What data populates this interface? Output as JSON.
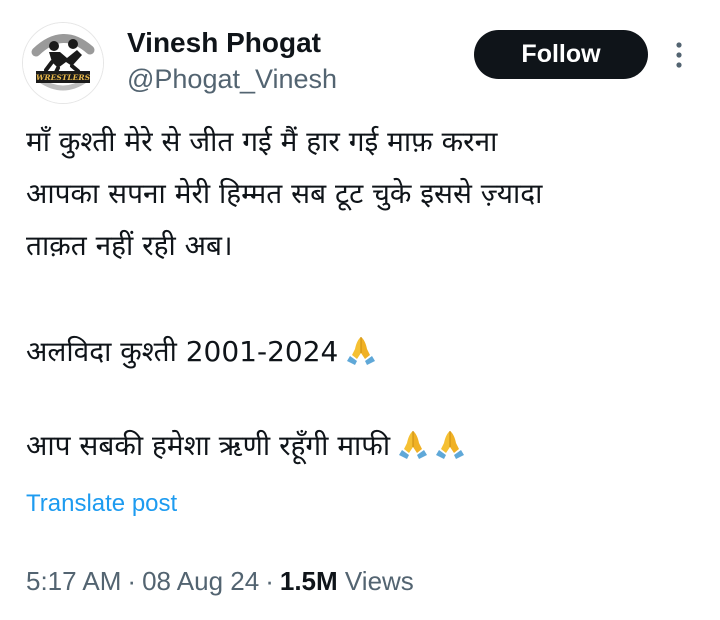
{
  "author": {
    "name": "Vinesh Phogat",
    "handle": "@Phogat_Vinesh",
    "avatar_text": "WRESTLERS",
    "avatar_icon": "wrestlers-logo"
  },
  "actions": {
    "follow_label": "Follow",
    "more_icon": "more-vertical-icon"
  },
  "tweet": {
    "lines": [
      "माँ कुश्ती मेरे से जीत गई मैं हार गई माफ़ करना",
      "आपका सपना मेरी हिम्मत सब टूट चुके इससे ज़्यादा",
      "ताक़त नहीं रही अब।",
      "अलविदा कुश्ती 2001-2024",
      "आप सबकी हमेशा ऋणी रहूँगी माफी"
    ],
    "emoji": "folded-hands-icon"
  },
  "translate_label": "Translate post",
  "meta": {
    "time": "5:17 AM",
    "separator": "·",
    "date": "08 Aug 24",
    "views_count": "1.5M",
    "views_label": "Views"
  },
  "colors": {
    "text": "#0f1419",
    "secondary": "#536471",
    "link": "#1d9bf0",
    "button": "#0f1419",
    "emoji_skin": "#f5c033",
    "emoji_sleeve": "#5fa8d8"
  }
}
